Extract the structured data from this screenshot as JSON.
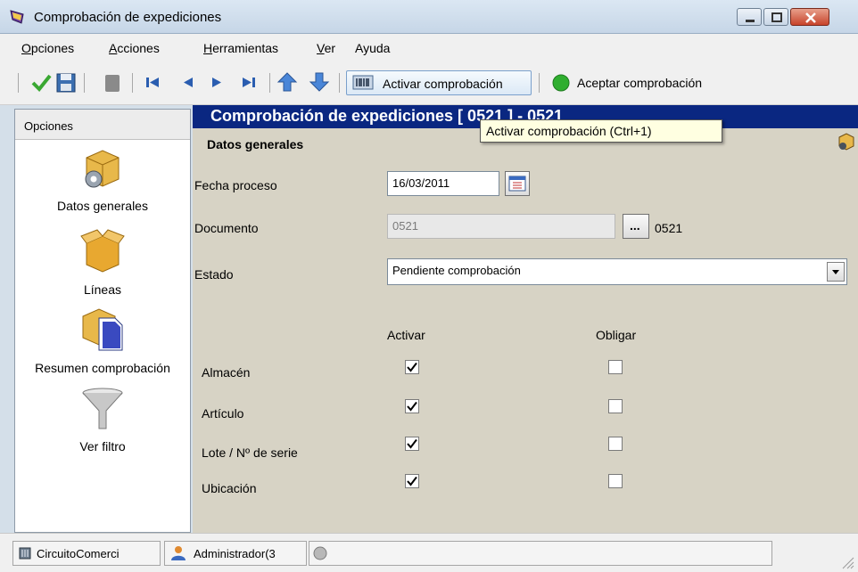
{
  "window": {
    "title": "Comprobación de expediciones"
  },
  "menu": [
    {
      "accel": "O",
      "rest": "pciones"
    },
    {
      "accel": "A",
      "rest": "cciones"
    },
    {
      "accel": "H",
      "rest": "erramientas"
    },
    {
      "accel": "V",
      "rest": "er"
    },
    {
      "accel": "",
      "rest": "Ayuda"
    }
  ],
  "toolbar": {
    "activar_label": "Activar comprobación",
    "aceptar_label": "Aceptar comprobación"
  },
  "tooltip": "Activar comprobación (Ctrl+1)",
  "left_panel": {
    "header": "Opciones",
    "items": [
      {
        "label": "Datos generales",
        "icon": "gear-box-icon"
      },
      {
        "label": "Líneas",
        "icon": "open-box-icon"
      },
      {
        "label": "Resumen comprobación",
        "icon": "box-document-icon"
      },
      {
        "label": "Ver filtro",
        "icon": "funnel-icon"
      }
    ]
  },
  "main": {
    "header": "Comprobación de expediciones  [ 0521 ] - 0521",
    "section": "Datos generales",
    "fecha_label": "Fecha proceso",
    "fecha_value": "16/03/2011",
    "documento_label": "Documento",
    "documento_value": "0521",
    "documento_desc": "0521",
    "lookup_label": "...",
    "estado_label": "Estado",
    "estado_value": "Pendiente comprobación",
    "col_activar": "Activar",
    "col_obligar": "Obligar",
    "rows": [
      {
        "label": "Almacén",
        "activar": true,
        "obligar": false
      },
      {
        "label": "Artículo",
        "activar": true,
        "obligar": false
      },
      {
        "label": "Lote / Nº de serie",
        "activar": true,
        "obligar": false
      },
      {
        "label": "Ubicación",
        "activar": true,
        "obligar": false
      }
    ]
  },
  "status": {
    "circuito": "CircuitoComerci",
    "usuario": "Administrador(3"
  },
  "colors": {
    "header_bg": "#0a2781",
    "form_bg": "#d7d3c5"
  }
}
